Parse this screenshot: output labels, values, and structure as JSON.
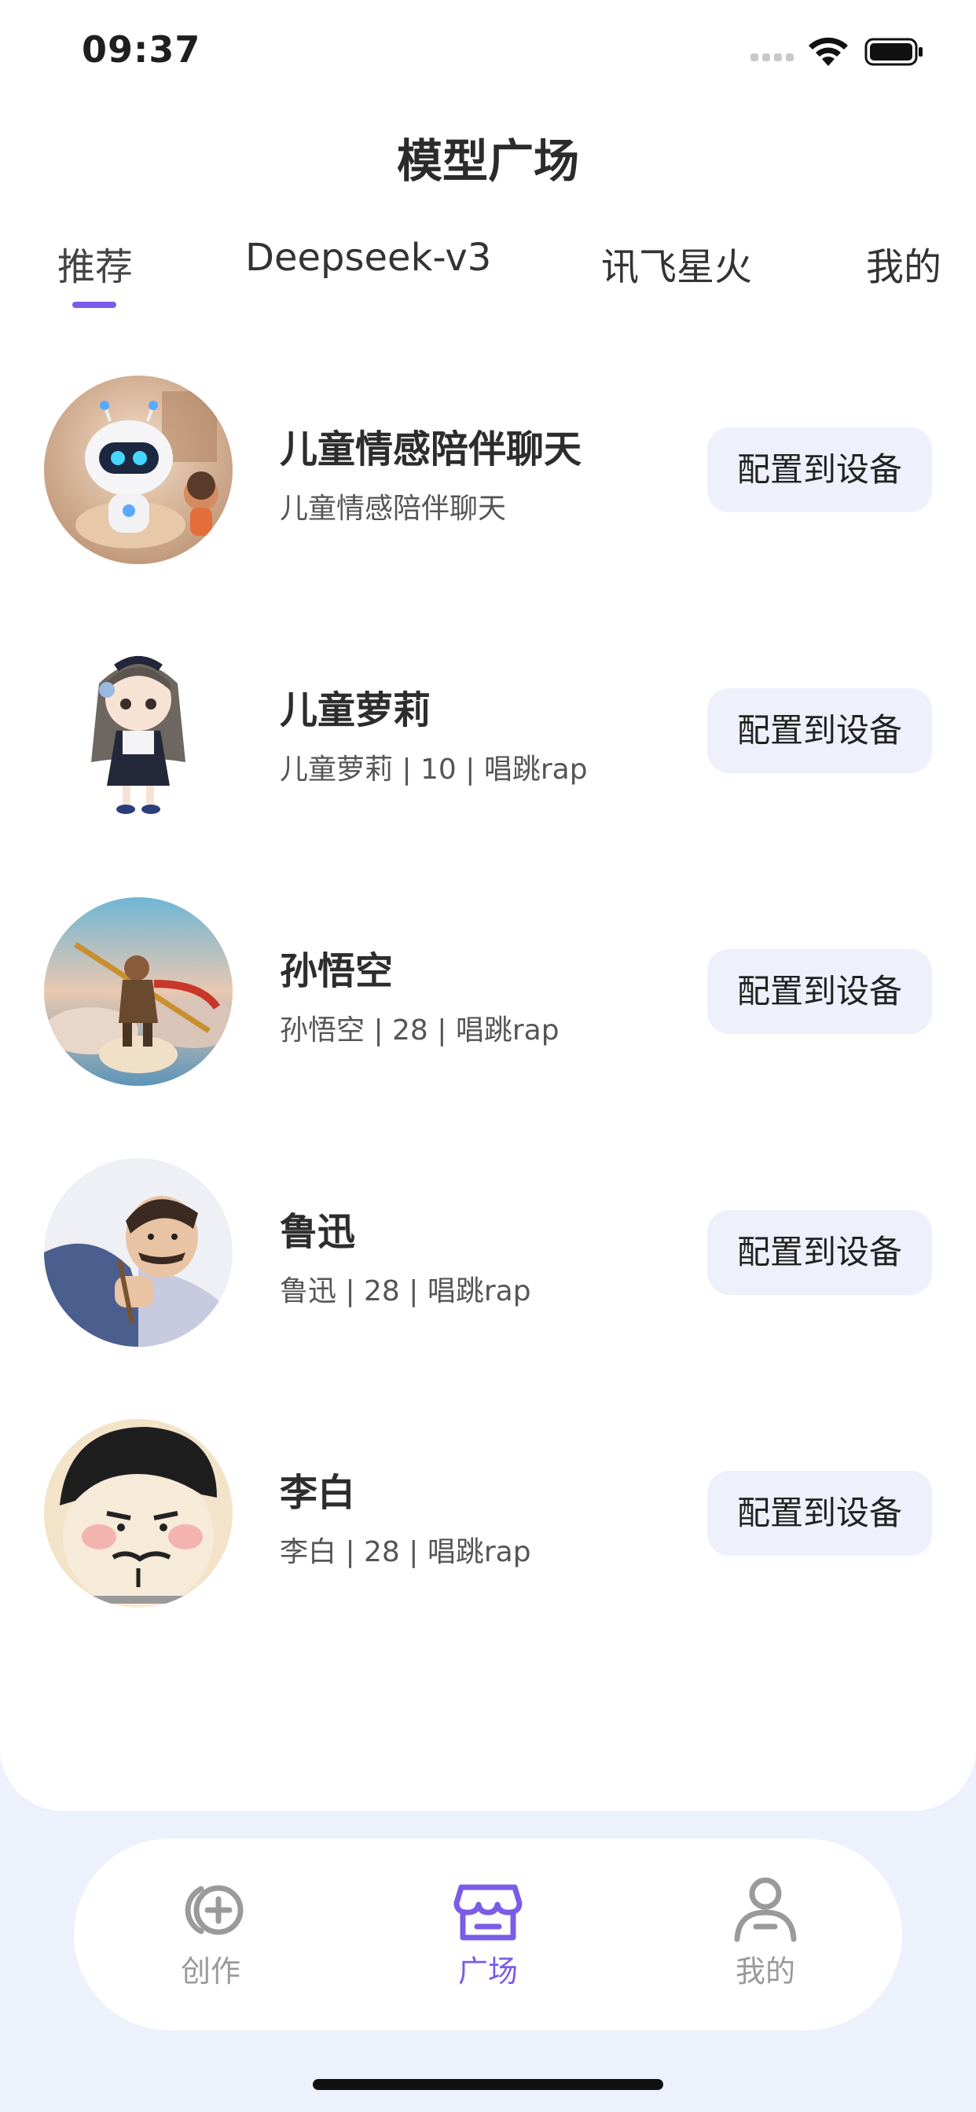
{
  "status_bar": {
    "time": "09:37"
  },
  "header": {
    "title": "模型广场"
  },
  "tabs": [
    {
      "label": "推荐",
      "active": true
    },
    {
      "label": "Deepseek-v3",
      "active": false
    },
    {
      "label": "讯飞星火",
      "active": false
    },
    {
      "label": "我的",
      "active": false
    }
  ],
  "models": [
    {
      "name": "儿童情感陪伴聊天",
      "desc": "儿童情感陪伴聊天",
      "button": "配置到设备",
      "avatar_icon": "robot-avatar"
    },
    {
      "name": "儿童萝莉",
      "desc": "儿童萝莉 | 10 | 唱跳rap",
      "button": "配置到设备",
      "avatar_icon": "anime-girl-avatar"
    },
    {
      "name": "孙悟空",
      "desc": "孙悟空 | 28 | 唱跳rap",
      "button": "配置到设备",
      "avatar_icon": "monkey-king-avatar"
    },
    {
      "name": "鲁迅",
      "desc": "鲁迅 | 28 | 唱跳rap",
      "button": "配置到设备",
      "avatar_icon": "lu-xun-avatar"
    },
    {
      "name": "李白",
      "desc": "李白 | 28 | 唱跳rap",
      "button": "配置到设备",
      "avatar_icon": "li-bai-avatar"
    }
  ],
  "bottom_nav": [
    {
      "label": "创作",
      "icon": "create-icon",
      "active": false
    },
    {
      "label": "广场",
      "icon": "store-icon",
      "active": true
    },
    {
      "label": "我的",
      "icon": "profile-icon",
      "active": false
    }
  ],
  "colors": {
    "accent": "#7B5CE6",
    "button_bg": "#EEF1FB",
    "page_bg": "#EDF1FB"
  }
}
